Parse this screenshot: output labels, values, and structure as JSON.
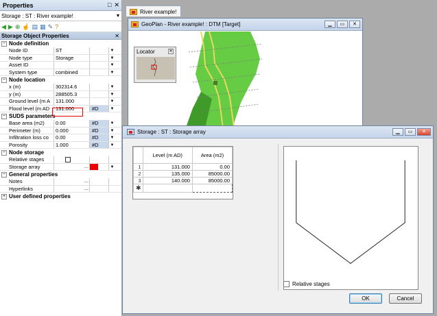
{
  "properties": {
    "title": "Properties",
    "selector": "Storage : ST : River example!",
    "section_title": "Storage Object Properties",
    "groups": [
      {
        "label": "Node definition",
        "toggle": "−",
        "rows": [
          {
            "label": "Node ID",
            "value": "ST",
            "flag": ""
          },
          {
            "label": "Node type",
            "value": "Storage",
            "flag": ""
          },
          {
            "label": "Asset ID",
            "value": "",
            "flag": ""
          },
          {
            "label": "System type",
            "value": "combined",
            "flag": ""
          }
        ]
      },
      {
        "label": "Node location",
        "toggle": "−",
        "rows": [
          {
            "label": "x (m)",
            "value": "302314.6",
            "flag": ""
          },
          {
            "label": "y (m)",
            "value": "288505.3",
            "flag": ""
          },
          {
            "label": "Ground level (m A",
            "value": "131.000",
            "flag": ""
          },
          {
            "label": "Flood level (m AD",
            "value": "131.000",
            "flag": "#D"
          }
        ]
      },
      {
        "label": "SUDS parameters",
        "toggle": "−",
        "rows": [
          {
            "label": "Base area (m2)",
            "value": "0.00",
            "flag": "#D"
          },
          {
            "label": "Perimeter (m)",
            "value": "0.000",
            "flag": "#D"
          },
          {
            "label": "Infiltration loss co",
            "value": "0.00",
            "flag": "#D"
          },
          {
            "label": "Porosity",
            "value": "1.000",
            "flag": "#D"
          }
        ]
      },
      {
        "label": "Node storage",
        "toggle": "−",
        "rows": [
          {
            "label": "Relative stages"
          },
          {
            "label": "Storage array"
          }
        ]
      },
      {
        "label": "General properties",
        "toggle": "−",
        "rows": [
          {
            "label": "Notes"
          },
          {
            "label": "Hyperlinks"
          }
        ]
      },
      {
        "label": "User defined properties",
        "toggle": "+"
      }
    ],
    "ellipsis": "..."
  },
  "document_tab": "River example!",
  "geoplan": {
    "title": "GeoPlan - River example! : DTM  [Target]",
    "locator_title": "Locator",
    "colors": {
      "terrain": "#5fcf3a",
      "river": "#e8d860"
    }
  },
  "storage_dialog": {
    "title": "Storage : ST : Storage array",
    "columns": [
      "Level (m AD)",
      "Area (m2)"
    ],
    "rows": [
      {
        "n": "1",
        "level": "131.000",
        "area": "0.00"
      },
      {
        "n": "2",
        "level": "135.000",
        "area": "85000.00"
      },
      {
        "n": "3",
        "level": "140.000",
        "area": "85000.00"
      }
    ],
    "new_row_marker": "✱",
    "relative_stages_label": "Relative stages",
    "ok_label": "OK",
    "cancel_label": "Cancel"
  },
  "icons": [
    "pin-icon",
    "close-icon",
    "back-arrow-icon",
    "forward-arrow-icon",
    "add-icon",
    "select-icon",
    "open-icon",
    "grid-icon",
    "edit-icon",
    "help-icon",
    "folder-icon",
    "map-icon"
  ]
}
